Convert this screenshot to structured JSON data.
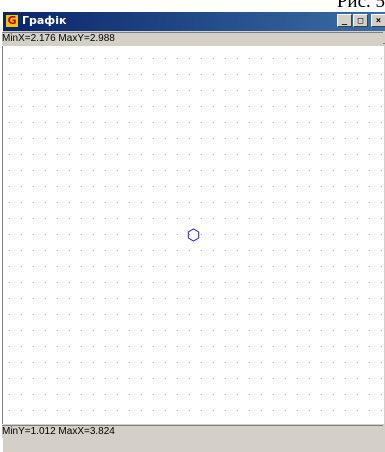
{
  "document": {
    "caption": "Рис. 5"
  },
  "window": {
    "title": "Графік",
    "app_icon_letter": "G",
    "controls": {
      "minimize": "_",
      "maximize": "□",
      "close": "×"
    }
  },
  "status": {
    "top": "MinX=2.176  MaxY=2.988",
    "bottom": "MinY=1.012  MaxX=3.824"
  },
  "plot": {
    "background": "#ffffff",
    "grid_dot_color": "#a0a0a0",
    "marker_color": "#2020d0",
    "marker_shape": "hexagon",
    "marker_point": {
      "x": 3.0,
      "y": 2.0
    }
  }
}
